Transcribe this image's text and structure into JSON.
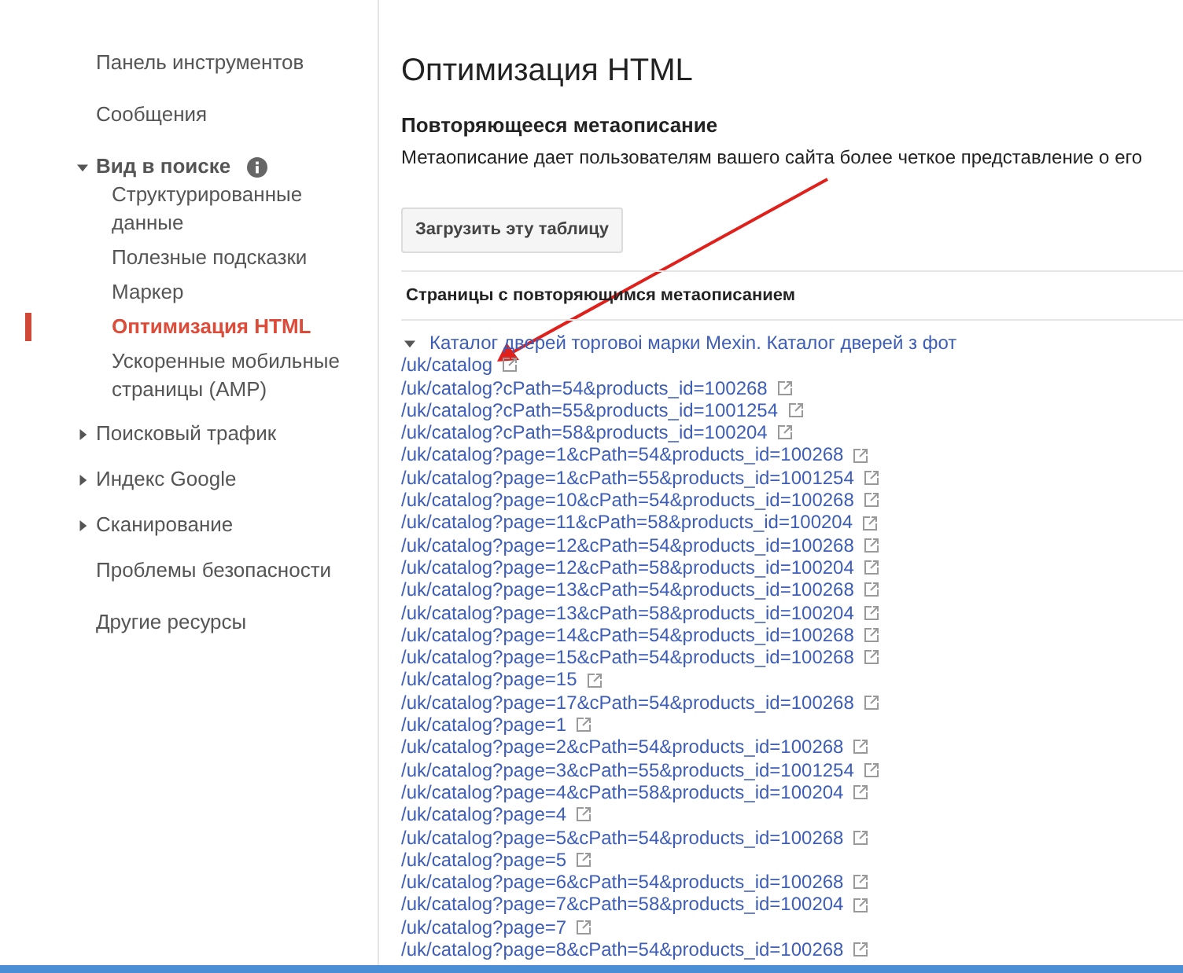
{
  "sidebar": {
    "items": [
      {
        "kind": "link",
        "label": "Панель инструментов"
      },
      {
        "kind": "link",
        "label": "Сообщения"
      },
      {
        "kind": "group",
        "label": "Вид в поиске",
        "expanded": true,
        "info": true,
        "children": [
          {
            "label": "Структурированные данные",
            "selected": false
          },
          {
            "label": "Полезные подсказки",
            "selected": false
          },
          {
            "label": "Маркер",
            "selected": false
          },
          {
            "label": "Оптимизация HTML",
            "selected": true
          },
          {
            "label": "Ускоренные мобильные страницы (AMP)",
            "selected": false
          }
        ]
      },
      {
        "kind": "group",
        "label": "Поисковый трафик",
        "expanded": false,
        "info": false
      },
      {
        "kind": "group",
        "label": "Индекс Google",
        "expanded": false,
        "info": false
      },
      {
        "kind": "group",
        "label": "Сканирование",
        "expanded": false,
        "info": false
      },
      {
        "kind": "link",
        "label": "Проблемы безопасности"
      },
      {
        "kind": "link",
        "label": "Другие ресурсы"
      }
    ]
  },
  "page": {
    "title": "Оптимизация HTML",
    "section_title": "Повторяющееся метаописание",
    "description": "Метаописание дает пользователям вашего сайта более четкое представление о его",
    "download_button": "Загрузить эту таблицу"
  },
  "table": {
    "column": "Страницы с повторяющимся метаописанием",
    "group": {
      "label": "Каталог дверей торговоі марки Mexin. Каталог дверей з фот",
      "expanded": true
    },
    "rows": [
      "/uk/catalog",
      "/uk/catalog?cPath=54&products_id=100268",
      "/uk/catalog?cPath=55&products_id=1001254",
      "/uk/catalog?cPath=58&products_id=100204",
      "/uk/catalog?page=1&cPath=54&products_id=100268",
      "/uk/catalog?page=1&cPath=55&products_id=1001254",
      "/uk/catalog?page=10&cPath=54&products_id=100268",
      "/uk/catalog?page=11&cPath=58&products_id=100204",
      "/uk/catalog?page=12&cPath=54&products_id=100268",
      "/uk/catalog?page=12&cPath=58&products_id=100204",
      "/uk/catalog?page=13&cPath=54&products_id=100268",
      "/uk/catalog?page=13&cPath=58&products_id=100204",
      "/uk/catalog?page=14&cPath=54&products_id=100268",
      "/uk/catalog?page=15&cPath=54&products_id=100268",
      "/uk/catalog?page=15",
      "/uk/catalog?page=17&cPath=54&products_id=100268",
      "/uk/catalog?page=1",
      "/uk/catalog?page=2&cPath=54&products_id=100268",
      "/uk/catalog?page=3&cPath=55&products_id=1001254",
      "/uk/catalog?page=4&cPath=58&products_id=100204",
      "/uk/catalog?page=4",
      "/uk/catalog?page=5&cPath=54&products_id=100268",
      "/uk/catalog?page=5",
      "/uk/catalog?page=6&cPath=54&products_id=100268",
      "/uk/catalog?page=7&cPath=58&products_id=100204",
      "/uk/catalog?page=7",
      "/uk/catalog?page=8&cPath=54&products_id=100268"
    ]
  }
}
